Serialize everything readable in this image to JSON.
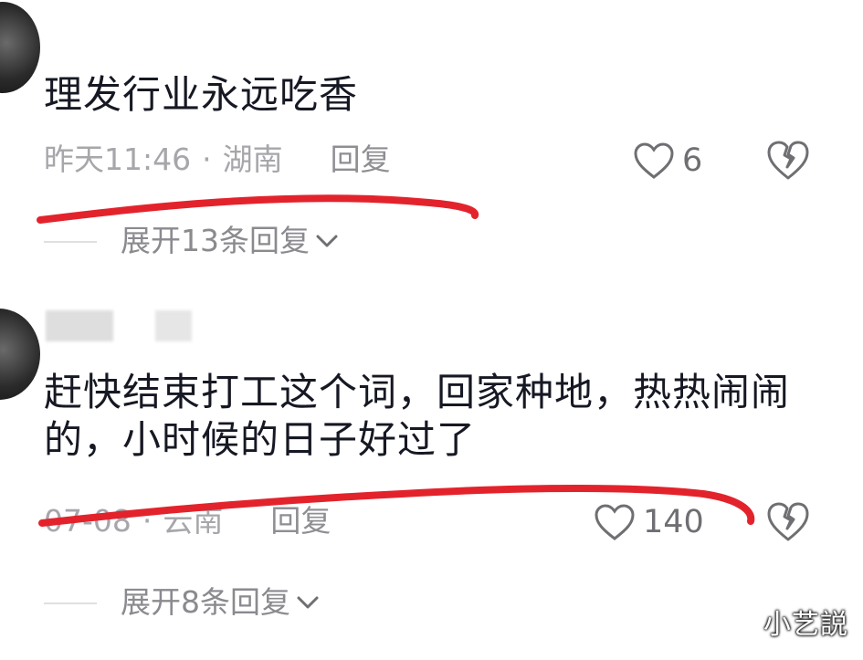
{
  "comments": [
    {
      "text": "理发行业永远吃香",
      "date": "昨天11:46",
      "separator": "·",
      "location": "湖南",
      "reply_label": "回复",
      "likes": "6",
      "expand_label": "展开13条回复"
    },
    {
      "text": "赶快结束打工这个词，回家种地，热热闹闹的，小时候的日子好过了",
      "date": "07-08",
      "separator": "·",
      "location": "云南",
      "reply_label": "回复",
      "likes": "140",
      "expand_label": "展开8条回复"
    }
  ],
  "watermark": "小艺説",
  "colors": {
    "annotation": "#e3232c",
    "text": "#161823",
    "meta": "#a6a6ab",
    "icon": "#6f6f73"
  },
  "icons": {
    "like": "heart-outline-icon",
    "dislike": "broken-heart-icon",
    "expand": "chevron-down-icon"
  }
}
